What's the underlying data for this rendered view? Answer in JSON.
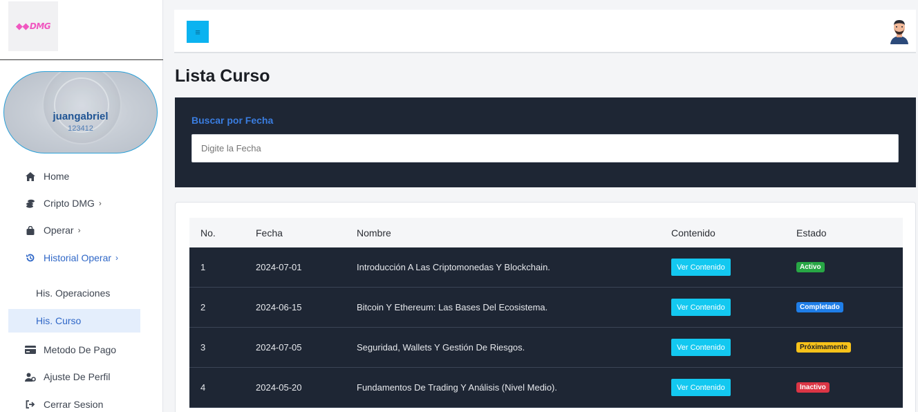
{
  "brand": {
    "logo_text": "DMG",
    "logo_mark": "◆◆"
  },
  "profile": {
    "username": "juangabriel",
    "user_id": "123412"
  },
  "sidebar": {
    "items": [
      {
        "label": "Home",
        "icon": "home-icon"
      },
      {
        "label": "Cripto DMG",
        "icon": "coins-icon"
      },
      {
        "label": "Operar",
        "icon": "bag-icon"
      },
      {
        "label": "Historial Operar",
        "icon": "history-icon"
      }
    ],
    "subitems": [
      {
        "label": "His. Operaciones"
      },
      {
        "label": "His. Curso"
      }
    ],
    "bottom_items": [
      {
        "label": "Metodo De Pago",
        "icon": "card-icon"
      },
      {
        "label": "Ajuste De Perfil",
        "icon": "user-cog-icon"
      },
      {
        "label": "Cerrar Sesion",
        "icon": "logout-icon"
      }
    ],
    "chevron": "›"
  },
  "topbar": {
    "menu_icon": "≡"
  },
  "page": {
    "title": "Lista Curso"
  },
  "search": {
    "label": "Buscar por Fecha",
    "placeholder": "Digite la Fecha",
    "value": ""
  },
  "table": {
    "columns": [
      "No.",
      "Fecha",
      "Nombre",
      "Contenido",
      "Estado"
    ],
    "button_label": "Ver Contenido",
    "rows": [
      {
        "no": "1",
        "fecha": "2024-07-01",
        "nombre": "Introducción A Las Criptomonedas Y Blockchain.",
        "estado": "Activo",
        "estado_color": "#28a745"
      },
      {
        "no": "2",
        "fecha": "2024-06-15",
        "nombre": "Bitcoin Y Ethereum: Las Bases Del Ecosistema.",
        "estado": "Completado",
        "estado_color": "#1f7ee8"
      },
      {
        "no": "3",
        "fecha": "2024-07-05",
        "nombre": "Seguridad, Wallets Y Gestión De Riesgos.",
        "estado": "Próximamente",
        "estado_color": "#f7c21a"
      },
      {
        "no": "4",
        "fecha": "2024-05-20",
        "nombre": "Fundamentos De Trading Y Análisis (Nivel Medio).",
        "estado": "Inactivo",
        "estado_color": "#dc3545"
      }
    ]
  },
  "colors": {
    "accent": "#2f67c7",
    "panel_dark": "#1e2634",
    "button_cyan": "#13c8f0",
    "menu_button": "#0bb3f0"
  }
}
